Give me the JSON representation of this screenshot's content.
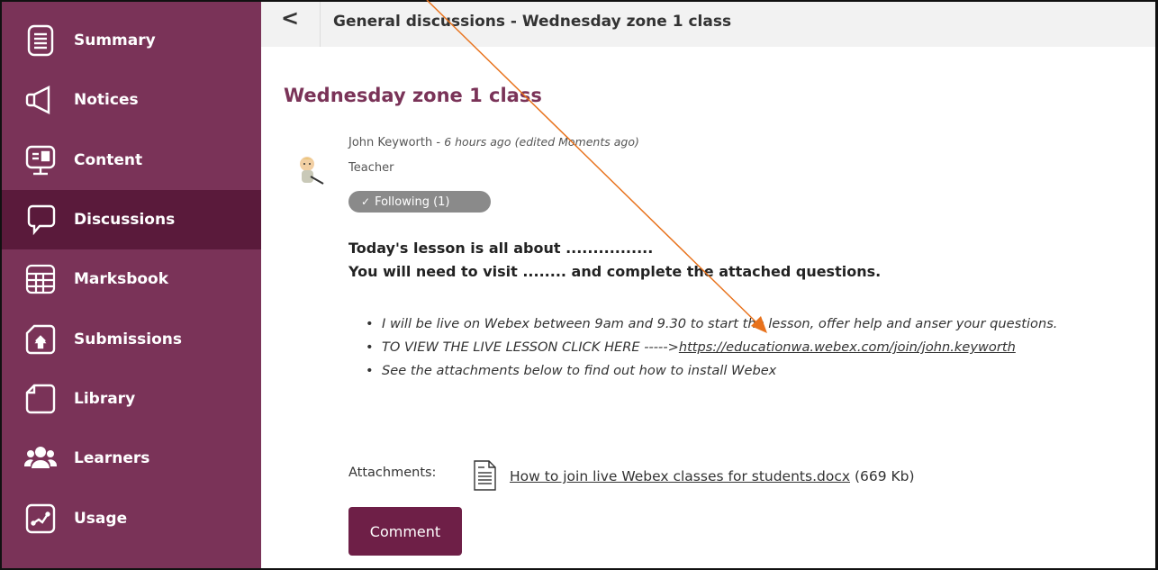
{
  "sidebar": {
    "items": [
      {
        "label": "Summary",
        "icon": "list-document-icon",
        "active": false
      },
      {
        "label": "Notices",
        "icon": "megaphone-icon",
        "active": false
      },
      {
        "label": "Content",
        "icon": "monitor-icon",
        "active": false
      },
      {
        "label": "Discussions",
        "icon": "speech-bubble-icon",
        "active": true
      },
      {
        "label": "Marksbook",
        "icon": "spreadsheet-icon",
        "active": false
      },
      {
        "label": "Submissions",
        "icon": "upload-icon",
        "active": false
      },
      {
        "label": "Library",
        "icon": "folder-icon",
        "active": false
      },
      {
        "label": "Learners",
        "icon": "people-icon",
        "active": false
      },
      {
        "label": "Usage",
        "icon": "line-chart-icon",
        "active": false
      }
    ]
  },
  "header": {
    "back_label": "<",
    "title": "General discussions - Wednesday zone 1 class"
  },
  "post": {
    "title": "Wednesday zone 1 class",
    "author": "John Keyworth",
    "separator": " - ",
    "time": "6 hours ago",
    "edited": "(edited Moments ago)",
    "role": "Teacher",
    "following_label": "Following (1)",
    "body_line1": "Today's lesson is all about ................",
    "body_line2": "You will need to visit ........ and complete the attached questions.",
    "bullets": {
      "b1": "I will be live on Webex between 9am and 9.30 to start the lesson, offer help and anser your questions.",
      "b2_prefix": "TO VIEW THE LIVE LESSON CLICK HERE ----->",
      "b2_link": "https://educationwa.webex.com/join/john.keyworth",
      "b3": "See the attachments below to find out how to install Webex"
    },
    "attachments_label": "Attachments:",
    "attachment_name": "How to join live Webex classes for students.docx",
    "attachment_size": "(669 Kb)",
    "comment_label": "Comment"
  },
  "colors": {
    "sidebar": "#7a3358",
    "sidebar_active": "#5a1a3b",
    "title_accent": "#7a3358",
    "annotation_arrow": "#e8721c"
  }
}
